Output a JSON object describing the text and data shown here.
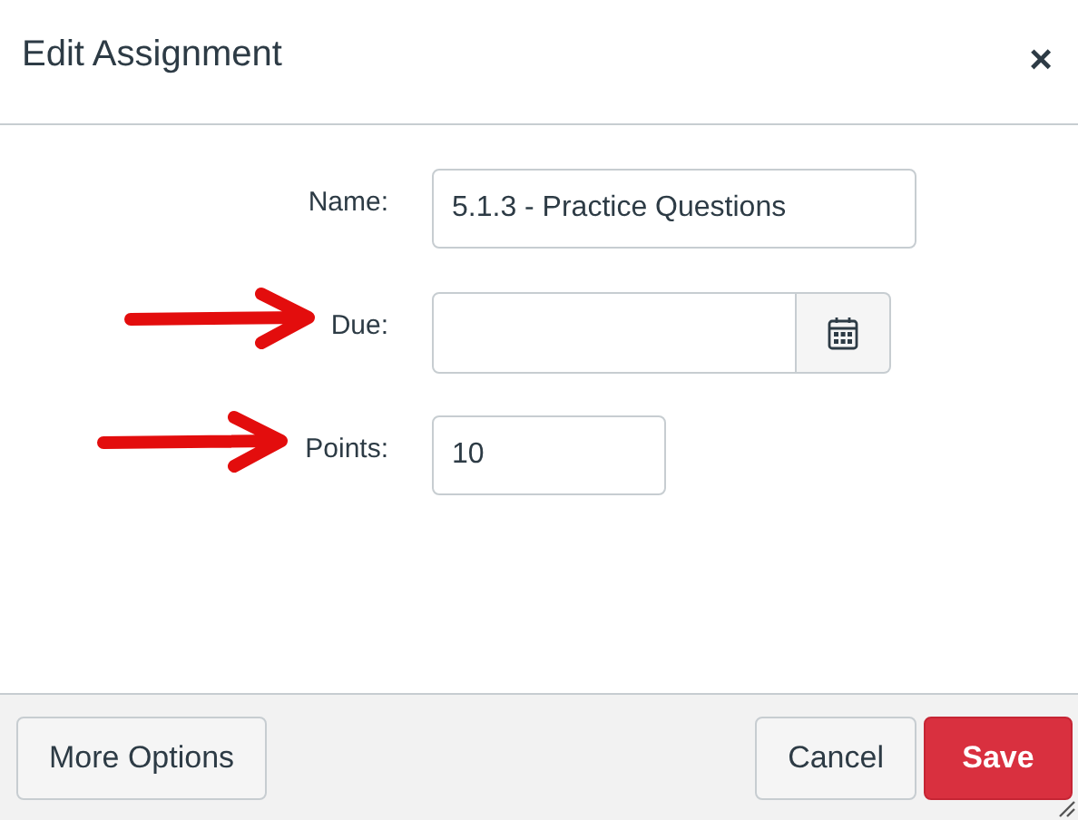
{
  "dialog": {
    "title": "Edit Assignment",
    "close": "×"
  },
  "fields": [
    {
      "kind": "text",
      "label": "Name:",
      "value": "5.1.3 - Practice Questions",
      "arrow": false
    },
    {
      "kind": "date",
      "label": "Due:",
      "arrow": true
    },
    {
      "kind": "number",
      "label": "Points:",
      "value": "10",
      "arrow": true
    }
  ],
  "footer": {
    "more_options": "More Options",
    "cancel": "Cancel",
    "save": "Save"
  }
}
